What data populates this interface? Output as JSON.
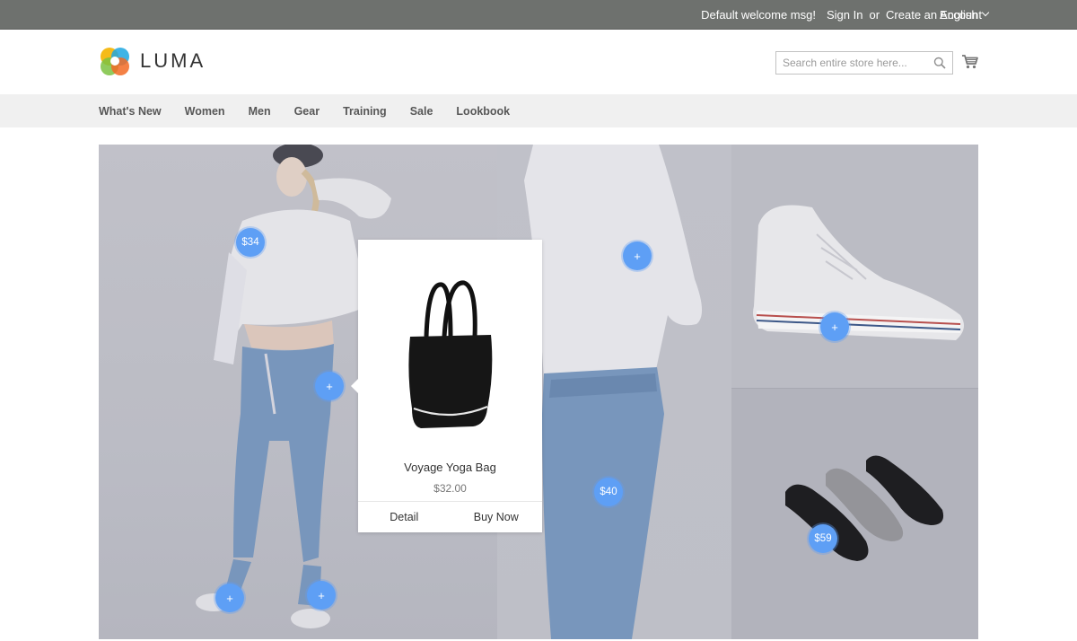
{
  "top_bar": {
    "welcome": "Default welcome msg!",
    "sign_in": "Sign In",
    "or": "or",
    "create_account": "Create an Account",
    "language": "English"
  },
  "header": {
    "logo_text": "LUMA",
    "search_placeholder": "Search entire store here...",
    "icons": [
      "search-icon",
      "cart-icon"
    ]
  },
  "nav": {
    "items": [
      "What's New",
      "Women",
      "Men",
      "Gear",
      "Training",
      "Sale",
      "Lookbook"
    ]
  },
  "lookbook": {
    "hotspots": [
      {
        "label": "$34"
      },
      {
        "label": "+"
      },
      {
        "label": "+"
      },
      {
        "label": "+"
      },
      {
        "label": "+"
      },
      {
        "label": "$40"
      },
      {
        "label": "+"
      },
      {
        "label": "$59"
      }
    ],
    "popup": {
      "product_name": "Voyage Yoga Bag",
      "price": "$32.00",
      "detail_label": "Detail",
      "buy_label": "Buy Now"
    }
  },
  "colors": {
    "top_bar": "#6e716e",
    "nav_bg": "#f0f0f0",
    "hotspot": "#5e9ff5"
  }
}
